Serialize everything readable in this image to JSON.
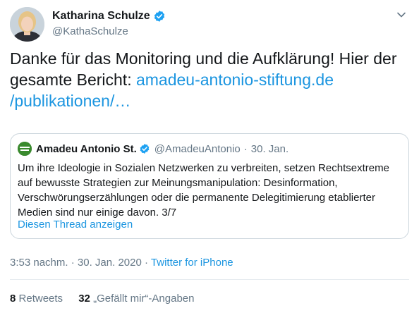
{
  "author": {
    "name": "Katharina Schulze",
    "handle": "@KathaSchulze",
    "verified": true
  },
  "tweet": {
    "text_before_link": "Danke für das Monitoring und die Aufklärung! Hier der gesamte Bericht: ",
    "link_line1": "amadeu-antonio-stiftung.de",
    "link_line2": "/publikationen/…"
  },
  "quoted_tweet": {
    "name": "Amadeu Antonio St.",
    "handle": "@AmadeuAntonio",
    "separator": "·",
    "date": "30. Jan.",
    "text": "Um ihre Ideologie in Sozialen Netzwerken zu verbreiten, setzen Rechtsextreme auf bewusste Strategien zur Meinungsmanipulation: Desinformation, Verschwörungserzählungen oder die permanente Delegitimierung etablierter Medien sind nur einige davon. 3/7",
    "show_thread": "Diesen Thread anzeigen"
  },
  "meta": {
    "time": "3:53 nachm.",
    "separator": "·",
    "date": "30. Jan. 2020",
    "source": "Twitter for iPhone"
  },
  "stats": {
    "retweets_count": "8",
    "retweets_label": "Retweets",
    "likes_count": "32",
    "likes_label": "„Gefällt mir“-Angaben"
  },
  "colors": {
    "link": "#1b95e0",
    "secondary_text": "#657786",
    "border": "#ccd6dd",
    "verified": "#1da1f2"
  }
}
